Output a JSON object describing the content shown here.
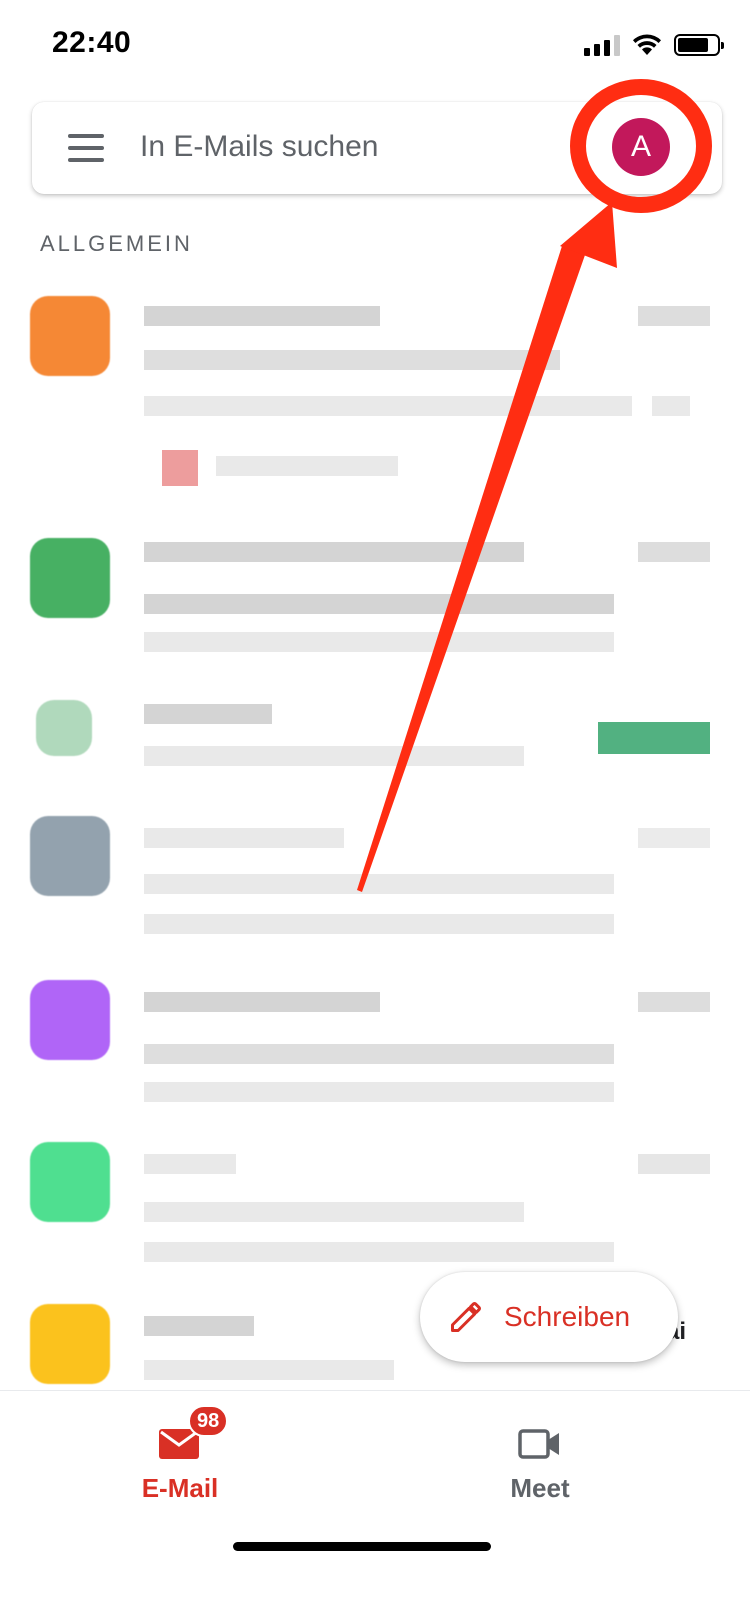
{
  "status_bar": {
    "time": "22:40"
  },
  "search": {
    "placeholder": "In E-Mails suchen",
    "avatar_initial": "A",
    "avatar_color": "#c2185b"
  },
  "section": {
    "label": "ALLGEMEIN"
  },
  "compose": {
    "label": "Schreiben"
  },
  "partial_text": "ai",
  "bottom_nav": {
    "mail_label": "E-Mail",
    "mail_badge": "98",
    "meet_label": "Meet"
  },
  "colors": {
    "accent_red": "#d93025",
    "annotation_red": "#ff2d12",
    "avatar_orange": "#f47c20",
    "avatar_green": "#34a853",
    "avatar_gray": "#8899a6",
    "avatar_purple": "#a855f7",
    "avatar_lightgreen": "#3ddc84",
    "avatar_yellow": "#fbbc05"
  },
  "icons": {
    "menu": "menu-icon",
    "compose": "pencil-icon",
    "mail": "envelope-icon",
    "meet": "video-camera-icon"
  }
}
